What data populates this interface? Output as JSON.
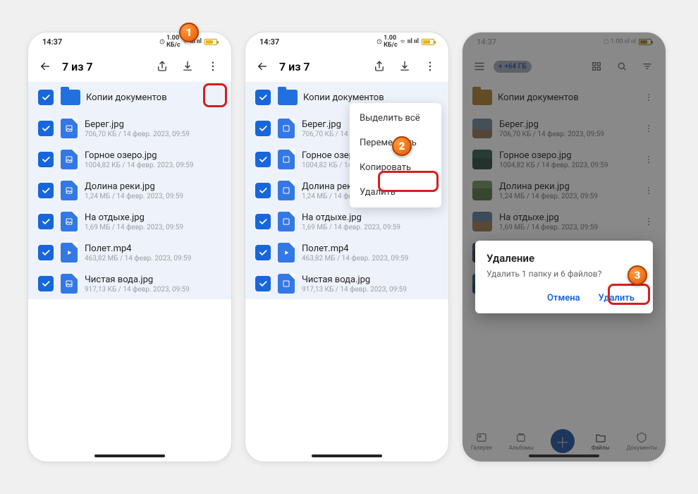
{
  "status": {
    "time": "14:37"
  },
  "selection_title": "7 из 7",
  "panel3": {
    "storage_pill": "+64 ГБ"
  },
  "items": [
    {
      "name": "Копии документов",
      "meta": ""
    },
    {
      "name": "Берег.jpg",
      "meta": "706,70 КБ / 14 февр. 2023, 09:59"
    },
    {
      "name": "Горное озеро.jpg",
      "meta": "1004,82 КБ / 14 февр. 2023, 09:59"
    },
    {
      "name": "Долина реки.jpg",
      "meta": "1,24 МБ / 14 февр. 2023, 09:59"
    },
    {
      "name": "На отдыхе.jpg",
      "meta": "1,69 МБ / 14 февр. 2023, 09:59"
    },
    {
      "name": "Полет.mp4",
      "meta": "463,82 МБ / 14 февр. 2023, 09:59"
    },
    {
      "name": "Чистая вода.jpg",
      "meta": "917,13 КБ / 14 февр. 2023, 09:59"
    }
  ],
  "menu": {
    "select_all": "Выделить всё",
    "move": "Переместить",
    "copy": "Копировать",
    "delete": "Удалить"
  },
  "dialog": {
    "title": "Удаление",
    "text": "Удалить 1 папку и 6 файлов?",
    "cancel": "Отмена",
    "confirm": "Удалить"
  },
  "nav": {
    "gallery": "Галерея",
    "albums": "Альбомы",
    "files": "Файлы",
    "docs": "Документы"
  },
  "thumbs": [
    "#e8a850",
    "linear-gradient(#8fb6d8 55%, #c19a6b 55%)",
    "linear-gradient(#3a7a64 45%, #2a5a4a 45%)",
    "linear-gradient(#9cc47a 40%, #6a9a52 40%)",
    "linear-gradient(#7aa7d0 50%, #d0a060 50%)",
    "linear-gradient(#556a88 40%, #3a4a60 40%)",
    "linear-gradient(#2a7fa8 55%, #1f5f80 55%)"
  ],
  "markers": {
    "m1": "1",
    "m2": "2",
    "m3": "3"
  }
}
